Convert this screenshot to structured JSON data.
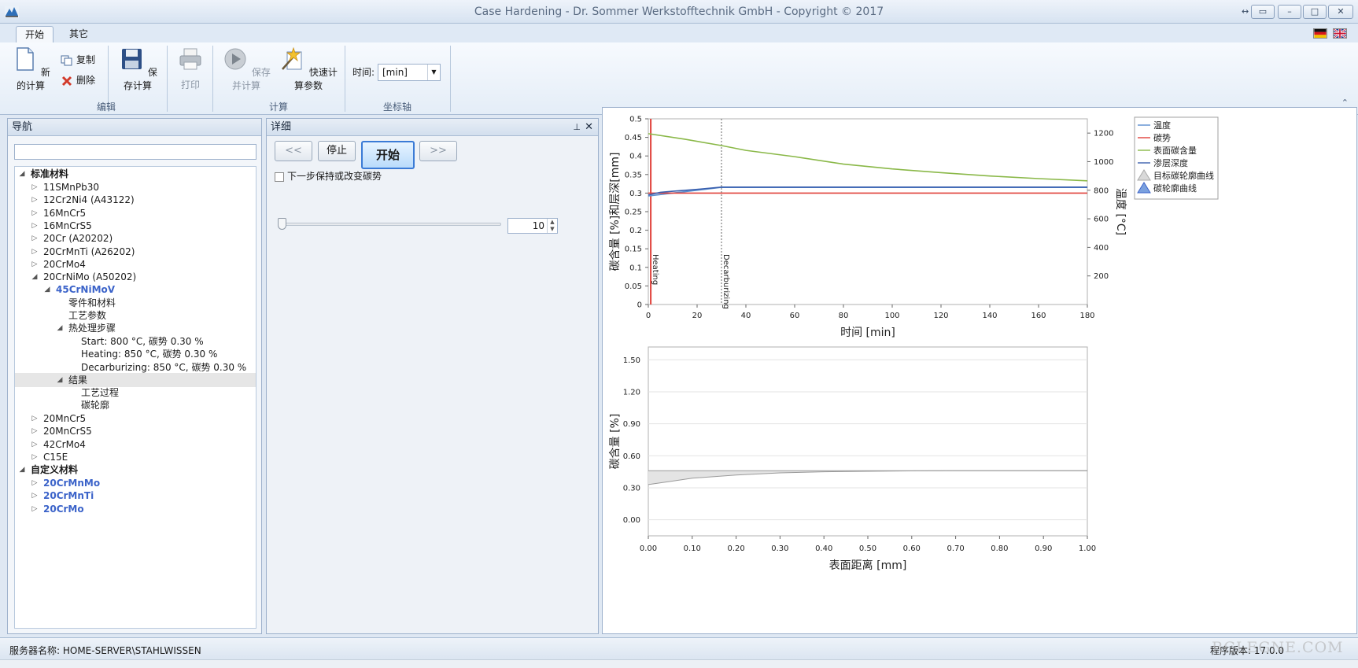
{
  "window": {
    "title": "Case Hardening - Dr. Sommer Werkstofftechnik GmbH - Copyright © 2017"
  },
  "ribbon": {
    "tabs": [
      "开始",
      "其它"
    ],
    "new_calc": "新的计算",
    "copy": "复制",
    "delete": "删除",
    "save_calc": "保存计算",
    "print": "打印",
    "save_and_calc": "保存并计算",
    "quick_params": "快速计算参数",
    "time_label": "时间:",
    "time_value": "[min]",
    "groups": {
      "edit": "编辑",
      "calc": "计算",
      "axis": "坐标轴"
    }
  },
  "nav": {
    "title": "导航",
    "search_value": "",
    "tree": {
      "standard": "标准材料",
      "mat1": "11SMnPb30",
      "mat2": "12Cr2Ni4 (A43122)",
      "mat3": "16MnCr5",
      "mat4": "16MnCrS5",
      "mat5": "20Cr (A20202)",
      "mat6": "20CrMnTi (A26202)",
      "mat7": "20CrMo4",
      "mat8": "20CrNiMo (A50202)",
      "mat8_child": "45CrNiMoV",
      "parts": "零件和材料",
      "process_params": "工艺参数",
      "heat_steps": "热处理步骤",
      "step_start": "Start:  800 °C,  碳势 0.30 %",
      "step_heating": "Heating:  850 °C,  碳势 0.30 %",
      "step_decarb": "Decarburizing:  850 °C,  碳势 0.30 %",
      "results": "结果",
      "res_process": "工艺过程",
      "res_profile": "碳轮廓",
      "mat9": "20MnCr5",
      "mat10": "20MnCrS5",
      "mat11": "42CrMo4",
      "mat12": "C15E",
      "custom": "自定义材料",
      "cust1": "20CrMnMo",
      "cust2": "20CrMnTi",
      "cust3": "20CrMo"
    }
  },
  "detail": {
    "title": "详细",
    "prev": "<<",
    "stop": "停止",
    "start": "开始",
    "next": ">>",
    "checkbox_label": "下一步保持或改变碳势",
    "stepper_value": "10",
    "slider_level": 0.0
  },
  "status": {
    "server": "服务器名称: HOME-SERVER\\STAHLWISSEN",
    "version": "程序版本: 17.0.0",
    "watermark": "RCLEGNE.COM"
  },
  "colors": {
    "temperature": "#5b8fd0",
    "carbon_potential": "#e0403a",
    "surface_carbon": "#8ab848",
    "case_depth": "#3a5fae",
    "accent_blue": "#3b63c9"
  },
  "chart_data": [
    {
      "type": "line",
      "xlabel": "时间 [min]",
      "ylabel": "碳含量 [%]和层深[mm]",
      "y2label": "温度 [°C]",
      "xlim": [
        0,
        180
      ],
      "ylim": [
        0,
        0.5
      ],
      "y2lim": [
        0,
        1300
      ],
      "x_ticks": [
        "0",
        "20",
        "40",
        "60",
        "80",
        "100",
        "120",
        "140",
        "160",
        "180"
      ],
      "y_ticks": [
        "0",
        "0.05",
        "0.1",
        "0.15",
        "0.2",
        "0.25",
        "0.3",
        "0.35",
        "0.4",
        "0.45",
        "0.5"
      ],
      "y2_ticks": [
        "200",
        "400",
        "600",
        "800",
        "1000",
        "1200"
      ],
      "legend": [
        "温度",
        "碳势",
        "表面碳含量",
        "渗层深度",
        "目标碳轮廓曲线",
        "碳轮廓曲线"
      ],
      "annotations": [
        {
          "label": "Heating",
          "x": 1
        },
        {
          "label": "Decarburizing",
          "x": 30
        }
      ],
      "series": [
        {
          "name": "温度",
          "axis": "y2",
          "x": [
            0,
            30,
            180
          ],
          "y": [
            760,
            820,
            820
          ]
        },
        {
          "name": "碳势",
          "x": [
            0,
            180
          ],
          "y": [
            0.3,
            0.3
          ]
        },
        {
          "name": "表面碳含量",
          "x": [
            0,
            15,
            30,
            40,
            60,
            80,
            100,
            120,
            140,
            160,
            180
          ],
          "y": [
            0.46,
            0.445,
            0.428,
            0.415,
            0.398,
            0.378,
            0.365,
            0.355,
            0.346,
            0.339,
            0.333
          ]
        },
        {
          "name": "渗层深度",
          "x": [
            0,
            5,
            10,
            20,
            30,
            180
          ],
          "y": [
            0.295,
            0.302,
            0.305,
            0.31,
            0.316,
            0.316
          ]
        }
      ]
    },
    {
      "type": "area",
      "xlabel": "表面距离 [mm]",
      "ylabel": "碳含量 [%]",
      "xlim": [
        0,
        1.0
      ],
      "ylim": [
        -0.15,
        1.62
      ],
      "x_ticks": [
        "0.00",
        "0.10",
        "0.20",
        "0.30",
        "0.40",
        "0.50",
        "0.60",
        "0.70",
        "0.80",
        "0.90",
        "1.00"
      ],
      "y_ticks": [
        "0.00",
        "0.30",
        "0.60",
        "0.90",
        "1.20",
        "1.50"
      ],
      "series": [
        {
          "name": "upper",
          "x": [
            0,
            0.1,
            0.2,
            0.3,
            0.5,
            0.7,
            1.0
          ],
          "y": [
            0.46,
            0.46,
            0.46,
            0.46,
            0.46,
            0.46,
            0.46
          ]
        },
        {
          "name": "lower",
          "x": [
            0,
            0.05,
            0.1,
            0.2,
            0.3,
            0.4,
            0.5,
            0.6,
            0.7,
            1.0
          ],
          "y": [
            0.33,
            0.36,
            0.39,
            0.42,
            0.44,
            0.45,
            0.455,
            0.458,
            0.46,
            0.46
          ]
        }
      ]
    }
  ]
}
